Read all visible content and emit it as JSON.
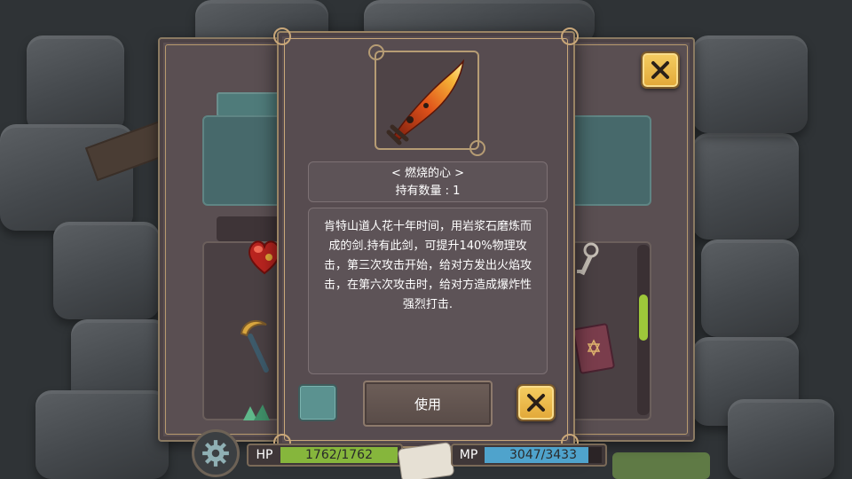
{
  "item": {
    "name": "< 燃烧的心 >",
    "quantity": "持有数量 : 1",
    "description": "肯特山道人花十年时间，用岩浆石磨炼而成的剑.持有此剑，可提升140%物理攻击，第三次攻击开始，给对方发出火焰攻击，在第六次攻击时，给对方造成爆炸性强烈打击.",
    "icon": "flame-sword-icon"
  },
  "buttons": {
    "use_label": "使用",
    "close_icon": "close-icon"
  },
  "hud": {
    "hp_label": "HP",
    "hp_value": "1762/1762",
    "hp_fraction": 1.0,
    "mp_label": "MP",
    "mp_value": "3047/3433",
    "mp_fraction": 0.8876,
    "settings_icon": "gear-icon"
  },
  "inventory": {
    "scroll_fraction": 0.4,
    "items": [
      {
        "icon": "ruby-heart-icon"
      },
      {
        "icon": "crescent-staff-icon"
      },
      {
        "icon": "key-icon"
      },
      {
        "icon": "spellbook-icon"
      }
    ]
  },
  "colors": {
    "hp_fill": "#86b63c",
    "mp_fill": "#4fa3cc",
    "panel": "#574c50",
    "gold": "#f1c45a"
  }
}
